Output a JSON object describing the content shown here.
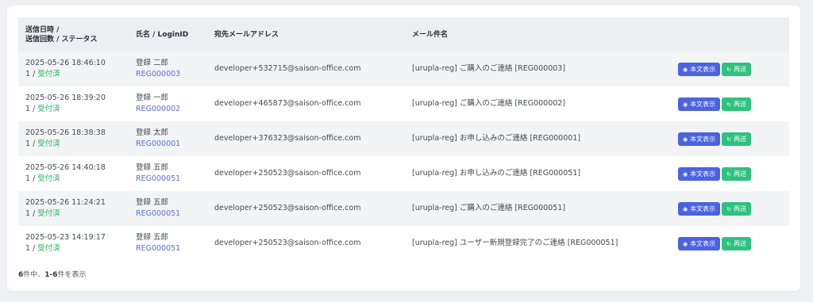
{
  "table": {
    "headers": {
      "datetime_line1": "送信日時 /",
      "datetime_line2": "送信回数 / ステータス",
      "name": "氏名 / LoginID",
      "email": "宛先メールアドレス",
      "subject": "メール件名",
      "actions": ""
    },
    "view_label": "本文表示",
    "resend_label": "再送",
    "rows": [
      {
        "datetime": "2025-05-26 18:46:10",
        "count": "1 / ",
        "status": "受付済",
        "name": "登録 二郎",
        "login_id": "REG000003",
        "email": "developer+532715@saison-office.com",
        "subject": "[urupla-reg] ご購入のご連絡 [REG000003]"
      },
      {
        "datetime": "2025-05-26 18:39:20",
        "count": "1 / ",
        "status": "受付済",
        "name": "登録 一郎",
        "login_id": "REG000002",
        "email": "developer+465873@saison-office.com",
        "subject": "[urupla-reg] ご購入のご連絡 [REG000002]"
      },
      {
        "datetime": "2025-05-26 18:38:38",
        "count": "1 / ",
        "status": "受付済",
        "name": "登録 太郎",
        "login_id": "REG000001",
        "email": "developer+376323@saison-office.com",
        "subject": "[urupla-reg] お申し込みのご連絡 [REG000001]"
      },
      {
        "datetime": "2025-05-26 14:40:18",
        "count": "1 / ",
        "status": "受付済",
        "name": "登録 五郎",
        "login_id": "REG000051",
        "email": "developer+250523@saison-office.com",
        "subject": "[urupla-reg] お申し込みのご連絡 [REG000051]"
      },
      {
        "datetime": "2025-05-26 11:24:21",
        "count": "1 / ",
        "status": "受付済",
        "name": "登録 五郎",
        "login_id": "REG000051",
        "email": "developer+250523@saison-office.com",
        "subject": "[urupla-reg] ご購入のご連絡 [REG000051]"
      },
      {
        "datetime": "2025-05-23 14:19:17",
        "count": "1 / ",
        "status": "受付済",
        "name": "登録 五郎",
        "login_id": "REG000051",
        "email": "developer+250523@saison-office.com",
        "subject": "[urupla-reg] ユーザー新規登録完了のご連絡 [REG000051]"
      }
    ]
  },
  "footer": {
    "total": "6",
    "total_suffix": "件中、",
    "range": "1-6",
    "range_suffix": "件を表示"
  },
  "colors": {
    "status": "#28b463",
    "login_id": "#5a6fd8",
    "view_button": "#4b63e0",
    "resend_button": "#2ec27e"
  },
  "icons": {
    "view": "eye-icon",
    "resend": "refresh-icon"
  }
}
